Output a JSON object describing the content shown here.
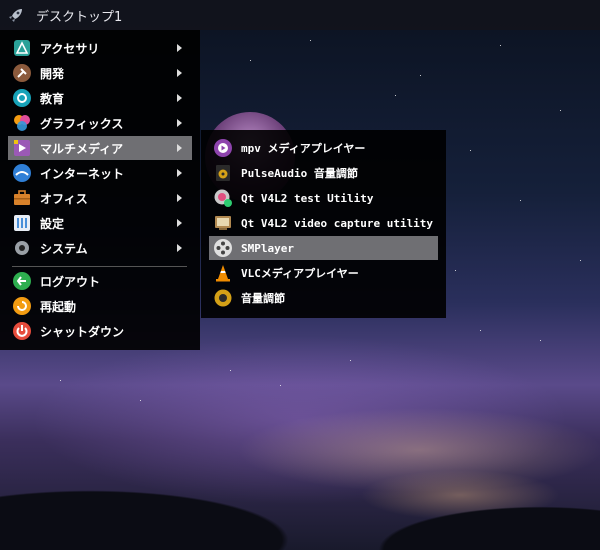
{
  "topbar": {
    "title": "デスクトップ1"
  },
  "main_menu": {
    "items": [
      {
        "label": "アクセサリ",
        "icon": "accessories-icon",
        "has_submenu": true,
        "selected": false,
        "color": "#2aa198"
      },
      {
        "label": "開発",
        "icon": "hammer-icon",
        "has_submenu": true,
        "selected": false,
        "color": "#8b5a3c"
      },
      {
        "label": "教育",
        "icon": "education-icon",
        "has_submenu": true,
        "selected": false,
        "color": "#17a2b8"
      },
      {
        "label": "グラフィックス",
        "icon": "graphics-icon",
        "has_submenu": true,
        "selected": false,
        "color": "#e04e9b"
      },
      {
        "label": "マルチメディア",
        "icon": "multimedia-icon",
        "has_submenu": true,
        "selected": true,
        "color": "#9b59b6"
      },
      {
        "label": "インターネット",
        "icon": "internet-icon",
        "has_submenu": true,
        "selected": false,
        "color": "#2f7fd6"
      },
      {
        "label": "オフィス",
        "icon": "office-icon",
        "has_submenu": true,
        "selected": false,
        "color": "#d9822b"
      },
      {
        "label": "設定",
        "icon": "settings-icon",
        "has_submenu": true,
        "selected": false,
        "color": "#4a90d9"
      },
      {
        "label": "システム",
        "icon": "gear-icon",
        "has_submenu": true,
        "selected": false,
        "color": "#9aa0a6"
      }
    ],
    "actions": [
      {
        "label": "ログアウト",
        "icon": "logout-icon",
        "color": "#2eae4f"
      },
      {
        "label": "再起動",
        "icon": "restart-icon",
        "color": "#f39c12"
      },
      {
        "label": "シャットダウン",
        "icon": "shutdown-icon",
        "color": "#e74c3c"
      }
    ]
  },
  "submenu": {
    "items": [
      {
        "label": "mpv メディアプレイヤー",
        "icon": "mpv-icon",
        "selected": false,
        "color": "#8e44ad"
      },
      {
        "label": "PulseAudio 音量調節",
        "icon": "speaker-icon",
        "selected": false,
        "color": "#d4a017"
      },
      {
        "label": "Qt V4L2 test Utility",
        "icon": "camera-test-icon",
        "selected": false,
        "color": "#e05080"
      },
      {
        "label": "Qt V4L2 video capture utility",
        "icon": "tv-icon",
        "selected": false,
        "color": "#b08850"
      },
      {
        "label": "SMPlayer",
        "icon": "film-reel-icon",
        "selected": true,
        "color": "#e0e0e0"
      },
      {
        "label": "VLCメディアプレイヤー",
        "icon": "vlc-cone-icon",
        "selected": false,
        "color": "#f08c00"
      },
      {
        "label": "音量調節",
        "icon": "volume-icon",
        "selected": false,
        "color": "#d4a017"
      }
    ]
  }
}
